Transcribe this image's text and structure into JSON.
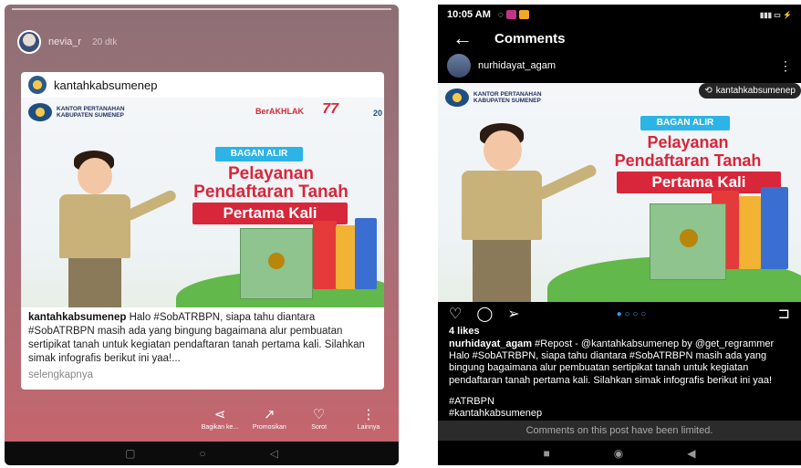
{
  "left": {
    "story_user": "nevia_r",
    "story_time": "20 dtk",
    "account": "kantahkabsumenep",
    "poster": {
      "org_line1": "KANTOR PERTANAHAN",
      "org_line2": "KABUPATEN SUMENEP",
      "brand": "BerAKHLAK",
      "badge77": "77",
      "badge20": "20",
      "pill": "BAGAN ALIR",
      "title1": "Pelayanan",
      "title2": "Pendaftaran Tanah",
      "banner": "Pertama Kali"
    },
    "caption_user": "kantahkabsumenep",
    "caption_text": "Halo #SobATRBPN, siapa tahu diantara #SobATRBPN masih ada yang bingung bagaimana alur pembuatan sertipikat tanah untuk kegiatan pendaftaran tanah pertama kali. Silahkan simak infografis berikut ini yaa!...",
    "more": "selengkapnya",
    "actions": [
      {
        "icon": "share-icon",
        "glyph": "⋖",
        "label": "Bagikan ke..."
      },
      {
        "icon": "trend-icon",
        "glyph": "↗",
        "label": "Promosikan"
      },
      {
        "icon": "highlight-icon",
        "glyph": "♡",
        "label": "Sorot"
      },
      {
        "icon": "more-icon",
        "glyph": "⋮",
        "label": "Lainnya"
      }
    ]
  },
  "right": {
    "time": "10:05 AM",
    "title": "Comments",
    "poster_user": "nurhidayat_agam",
    "repost_tag": "kantahkabsumenep",
    "likes": "4 likes",
    "caption_user": "nurhidayat_agam",
    "caption_text": "#Repost - @kantahkabsumenep by @get_regrammer Halo #SobATRBPN, siapa tahu diantara #SobATRBPN masih ada yang bingung bagaimana alur pembuatan sertipikat tanah untuk kegiatan pendaftaran tanah pertama kali. Silahkan simak infografis berikut ini yaa!",
    "tag1": "#ATRBPN",
    "tag2": "#kantahkabsumenep",
    "limited": "Comments on this post have been limited."
  },
  "colors": {
    "accent_red": "#d8263a",
    "accent_blue": "#2bb4e5",
    "ig_blue": "#3897f0"
  }
}
